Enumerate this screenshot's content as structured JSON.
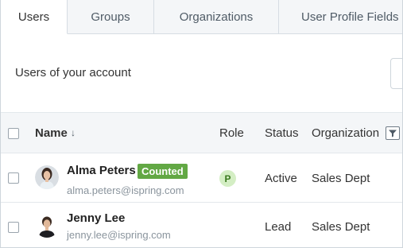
{
  "tabs": [
    {
      "label": "Users",
      "active": true
    },
    {
      "label": "Groups",
      "active": false
    },
    {
      "label": "Organizations",
      "active": false
    },
    {
      "label": "User Profile Fields",
      "active": false
    }
  ],
  "header": {
    "title": "Users of your account"
  },
  "table": {
    "columns": {
      "name": "Name",
      "sort_indicator": "↓",
      "role": "Role",
      "status": "Status",
      "organization": "Organization"
    },
    "rows": [
      {
        "name": "Alma Peters",
        "badge": "Counted",
        "email": "alma.peters@ispring.com",
        "role": "P",
        "status": "Active",
        "organization": "Sales Dept"
      },
      {
        "name": "Jenny Lee",
        "email": "jenny.lee@ispring.com",
        "role": "",
        "status": "Lead",
        "organization": "Sales Dept"
      }
    ]
  },
  "colors": {
    "badge_green": "#62a844",
    "role_badge_bg": "#d4eec4",
    "tab_inactive_bg": "#f4f6f8",
    "header_bg": "#f4f6f8"
  },
  "icons": {
    "sort": "arrow-down-icon",
    "filter": "filter-icon"
  }
}
